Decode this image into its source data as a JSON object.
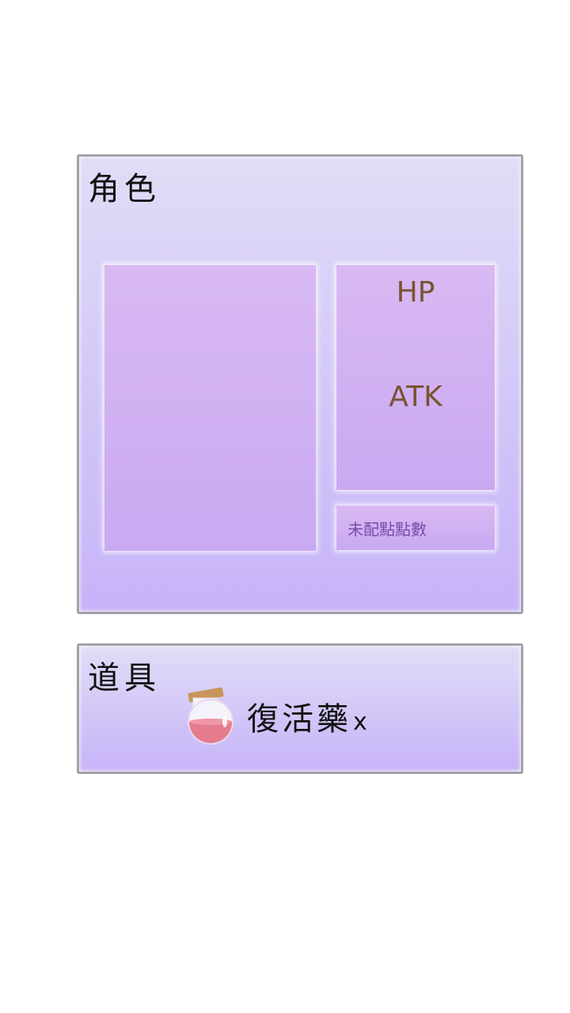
{
  "character_panel": {
    "title": "角色",
    "stats": {
      "hp_label": "HP",
      "atk_label": "ATK"
    },
    "unallocated_points_label": "未配點點數"
  },
  "items_panel": {
    "title": "道具",
    "items": [
      {
        "name": "復活藥",
        "count_prefix": "x",
        "icon": "potion-icon"
      }
    ]
  },
  "colors": {
    "panel_border": "#a3a1a8",
    "panel_top": "#e2dcf7",
    "panel_bottom": "#c7b3f8",
    "inner_box": "#d0b0f2",
    "stat_text": "#7a5230",
    "points_text": "#7a4aa8"
  }
}
